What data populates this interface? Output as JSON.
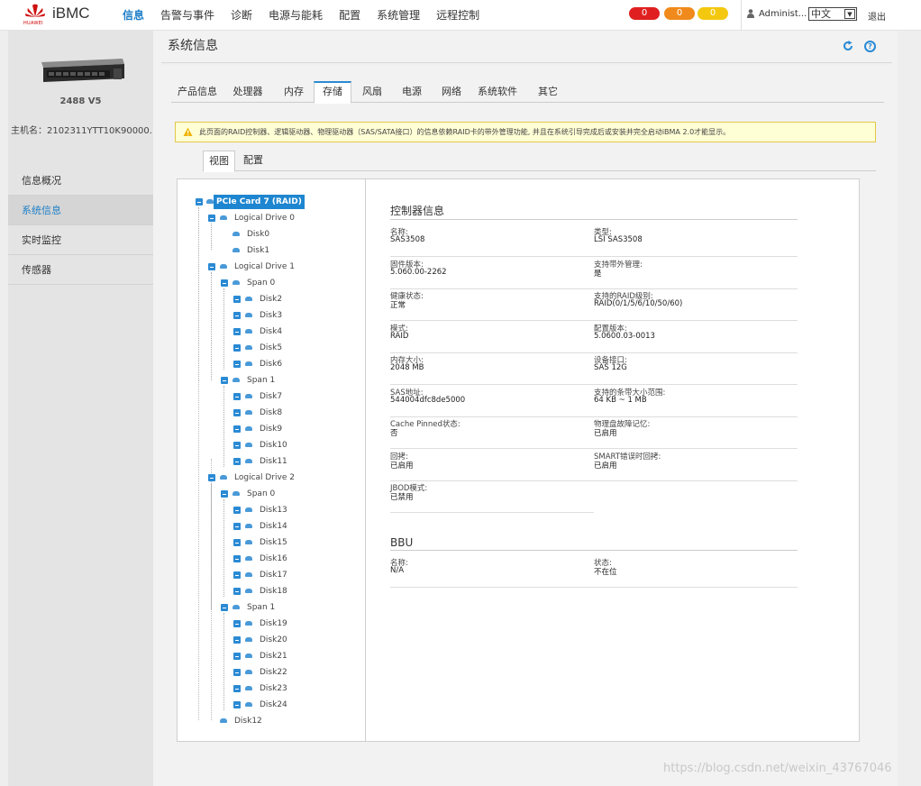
{
  "header": {
    "logo_caption": "HUAWEI",
    "brand": "iBMC",
    "nav": [
      "信息",
      "告警与事件",
      "诊断",
      "电源与能耗",
      "配置",
      "系统管理",
      "远程控制"
    ],
    "alarms": [
      {
        "count": "0",
        "color": "#e02020"
      },
      {
        "count": "0",
        "color": "#f08a1c"
      },
      {
        "count": "0",
        "color": "#f3c80f"
      }
    ],
    "user": "Administ...",
    "language": "中文",
    "logout": "退出"
  },
  "sidebar": {
    "model": "2488 V5",
    "hostname": "主机名：2102311YTT10K90000...",
    "items": [
      "信息概况",
      "系统信息",
      "实时监控",
      "传感器"
    ],
    "active_index": 1
  },
  "page": {
    "title": "系统信息",
    "tabs": [
      "产品信息",
      "处理器",
      "内存",
      "存储",
      "风扇",
      "电源",
      "网络",
      "系统软件",
      "其它"
    ],
    "active_tab": "存储",
    "notice": "此页面的RAID控制器、逻辑驱动器、物理驱动器（SAS/SATA接口）的信息依赖RAID卡的带外管理功能, 并且在系统引导完成后或安装并完全启动iBMA 2.0才能显示。",
    "subtabs": [
      "视图",
      "配置"
    ]
  },
  "tree": {
    "root": "PCIe Card 7 (RAID)",
    "ld0": "Logical Drive 0",
    "ld0_disks": [
      "Disk0",
      "Disk1"
    ],
    "ld1": "Logical Drive 1",
    "ld1_span0": "Span 0",
    "ld1_span0_disks": [
      "Disk2",
      "Disk3",
      "Disk4",
      "Disk5",
      "Disk6"
    ],
    "ld1_span1": "Span 1",
    "ld1_span1_disks": [
      "Disk7",
      "Disk8",
      "Disk9",
      "Disk10",
      "Disk11"
    ],
    "ld2": "Logical Drive 2",
    "ld2_span0": "Span 0",
    "ld2_span0_disks": [
      "Disk13",
      "Disk14",
      "Disk15",
      "Disk16",
      "Disk17",
      "Disk18"
    ],
    "ld2_span1": "Span 1",
    "ld2_span1_disks": [
      "Disk19",
      "Disk20",
      "Disk21",
      "Disk22",
      "Disk23",
      "Disk24"
    ],
    "standalone": "Disk12"
  },
  "controller": {
    "title": "控制器信息",
    "fields": [
      {
        "label": "名称:",
        "value": "SAS3508"
      },
      {
        "label": "类型:",
        "value": "LSI SAS3508"
      },
      {
        "label": "固件版本:",
        "value": "5.060.00-2262"
      },
      {
        "label": "支持带外管理:",
        "value": "是"
      },
      {
        "label": "健康状态:",
        "value": "正常"
      },
      {
        "label": "支持的RAID级别:",
        "value": "RAID(0/1/5/6/10/50/60)"
      },
      {
        "label": "模式:",
        "value": "RAID"
      },
      {
        "label": "配置版本:",
        "value": "5.0600.03-0013"
      },
      {
        "label": "内存大小:",
        "value": "2048 MB"
      },
      {
        "label": "设备接口:",
        "value": "SAS 12G"
      },
      {
        "label": "SAS地址:",
        "value": "544004dfc8de5000"
      },
      {
        "label": "支持的条带大小范围:",
        "value": "64 KB ~ 1 MB"
      },
      {
        "label": "Cache Pinned状态:",
        "value": "否"
      },
      {
        "label": "物理盘故障记忆:",
        "value": "已启用"
      },
      {
        "label": "回拷:",
        "value": "已启用"
      },
      {
        "label": "SMART错误时回拷:",
        "value": "已启用"
      },
      {
        "label": "JBOD模式:",
        "value": "已禁用"
      }
    ]
  },
  "bbu": {
    "title": "BBU",
    "fields": [
      {
        "label": "名称:",
        "value": "N/A"
      },
      {
        "label": "状态:",
        "value": "不在位"
      }
    ]
  },
  "watermark": "https://blog.csdn.net/weixin_43767046"
}
